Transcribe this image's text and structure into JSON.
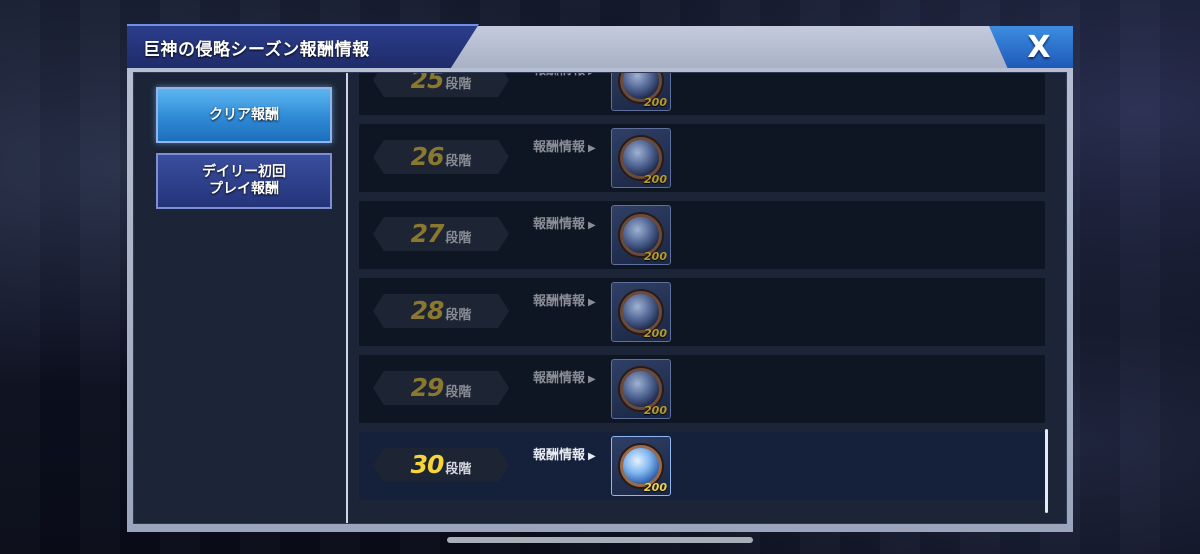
{
  "dialog": {
    "title": "巨神の侵略シーズン報酬情報",
    "close_label": "X"
  },
  "sidebar": {
    "items": [
      {
        "label": "クリア報酬",
        "active": true
      },
      {
        "label": "デイリー初回\nプレイ報酬",
        "active": false
      }
    ]
  },
  "list": {
    "unit_label": "段階",
    "info_label": "報酬情報",
    "rows": [
      {
        "stage": "25",
        "reward_qty": "200"
      },
      {
        "stage": "26",
        "reward_qty": "200"
      },
      {
        "stage": "27",
        "reward_qty": "200"
      },
      {
        "stage": "28",
        "reward_qty": "200"
      },
      {
        "stage": "29",
        "reward_qty": "200"
      },
      {
        "stage": "30",
        "reward_qty": "200"
      }
    ]
  },
  "colors": {
    "stage_active": "#f6d53a",
    "stage_inactive": "#8a7730",
    "accent_blue": "#2f8ad5"
  },
  "icons": [
    "close-icon",
    "play-arrow-icon",
    "orb-reward-icon"
  ]
}
